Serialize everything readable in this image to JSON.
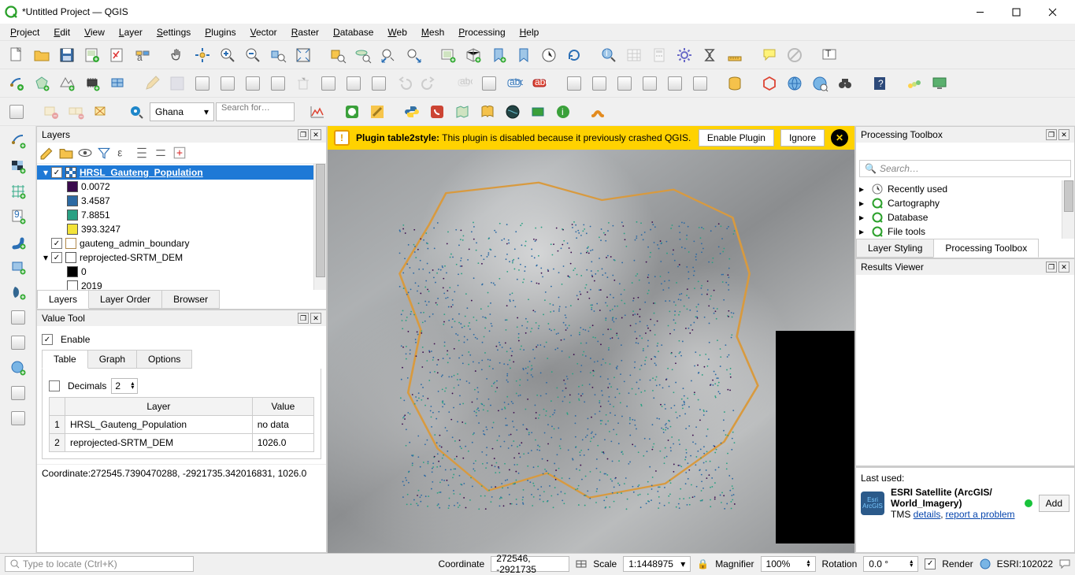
{
  "window": {
    "title": "*Untitled Project — QGIS"
  },
  "menu": [
    "Project",
    "Edit",
    "View",
    "Layer",
    "Settings",
    "Plugins",
    "Vector",
    "Raster",
    "Database",
    "Web",
    "Mesh",
    "Processing",
    "Help"
  ],
  "toolbar3": {
    "combo_value": "Ghana",
    "search_placeholder": "Search for…"
  },
  "layers_panel": {
    "title": "Layers",
    "tabs": [
      "Layers",
      "Layer Order",
      "Browser"
    ],
    "tree": [
      {
        "type": "group",
        "expanded": true,
        "checked": true,
        "swatch_pattern": "checker",
        "label": "HRSL_Gauteng_Population",
        "selected": true
      },
      {
        "type": "class",
        "color": "#3a0b4d",
        "label": "0.0072"
      },
      {
        "type": "class",
        "color": "#2d6aa3",
        "label": "3.4587"
      },
      {
        "type": "class",
        "color": "#2aa083",
        "label": "7.8851"
      },
      {
        "type": "class",
        "color": "#f3e338",
        "label": "393.3247"
      },
      {
        "type": "layer",
        "checked": true,
        "swatch": "#ffffff",
        "border": "#b0884a",
        "label": "gauteng_admin_boundary"
      },
      {
        "type": "group",
        "expanded": true,
        "checked": true,
        "swatch": "#ffffff",
        "label": "reprojected-SRTM_DEM"
      },
      {
        "type": "class",
        "color": "#000000",
        "label": "0"
      },
      {
        "type": "class",
        "color": "#ffffff",
        "label": "2019"
      }
    ]
  },
  "value_tool": {
    "title": "Value Tool",
    "enable_label": "Enable",
    "enable_checked": true,
    "tabs": [
      "Table",
      "Graph",
      "Options"
    ],
    "decimals_label": "Decimals",
    "decimals_value": "2",
    "columns": [
      "Layer",
      "Value"
    ],
    "rows": [
      {
        "n": "1",
        "layer": "HRSL_Gauteng_Population",
        "value": "no data"
      },
      {
        "n": "2",
        "layer": "reprojected-SRTM_DEM",
        "value": "1026.0"
      }
    ],
    "coord_label": "Coordinate:",
    "coord_value": "272545.7390470288, -2921735.342016831, 1026.0"
  },
  "notice": {
    "prefix": "Plugin table2style:",
    "text": "This plugin is disabled because it previously crashed QGIS.",
    "enable": "Enable Plugin",
    "ignore": "Ignore"
  },
  "processing": {
    "title": "Processing Toolbox",
    "search_placeholder": "Search…",
    "items": [
      "Recently used",
      "Cartography",
      "Database",
      "File tools"
    ],
    "tabs": [
      "Layer Styling",
      "Processing Toolbox"
    ]
  },
  "results_viewer": {
    "title": "Results Viewer"
  },
  "last_used": {
    "header": "Last used:",
    "title1": "ESRI Satellite (ArcGIS/",
    "title2": "World_Imagery)",
    "meta_prefix": "TMS ",
    "link1": "details",
    "link2": "report a problem",
    "add": "Add"
  },
  "status": {
    "locator_placeholder": "Type to locate (Ctrl+K)",
    "coordinate_label": "Coordinate",
    "coordinate_value": "272546, -2921735",
    "scale_label": "Scale",
    "scale_value": "1:1448975",
    "magnifier_label": "Magnifier",
    "magnifier_value": "100%",
    "rotation_label": "Rotation",
    "rotation_value": "0.0 °",
    "render_label": "Render",
    "crs": "ESRI:102022"
  }
}
